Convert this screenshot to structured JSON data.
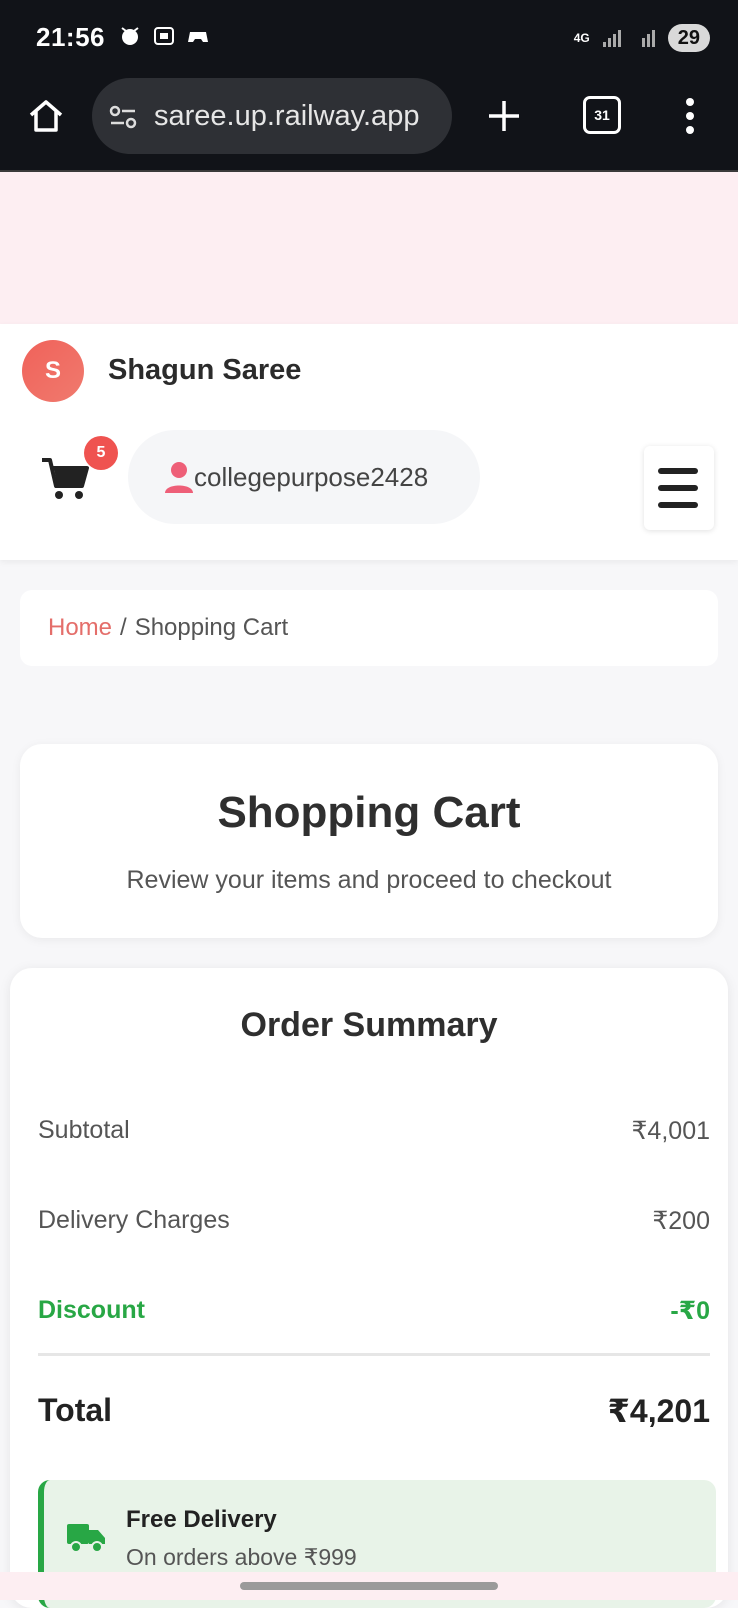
{
  "status_bar": {
    "time": "21:56",
    "network": "4G",
    "battery": "29"
  },
  "browser": {
    "url": "saree.up.railway.app",
    "tab_count": "31"
  },
  "site": {
    "logo_letter": "S",
    "brand_name": "Shagun Saree"
  },
  "header": {
    "cart_count": "5",
    "username": "collegepurpose2428"
  },
  "breadcrumb": {
    "home": "Home",
    "separator": "/",
    "current": "Shopping Cart"
  },
  "page": {
    "title": "Shopping Cart",
    "subtitle": "Review your items and proceed to checkout"
  },
  "summary": {
    "title": "Order Summary",
    "subtotal_label": "Subtotal",
    "subtotal_value": "₹4,001",
    "delivery_label": "Delivery Charges",
    "delivery_value": "₹200",
    "discount_label": "Discount",
    "discount_value": "-₹0",
    "total_label": "Total",
    "total_value": "₹4,201",
    "promo_title": "Free Delivery",
    "promo_subtitle": "On orders above ₹999"
  },
  "colors": {
    "accent": "#e46e6a",
    "success": "#28a745",
    "badge": "#ef5350"
  }
}
